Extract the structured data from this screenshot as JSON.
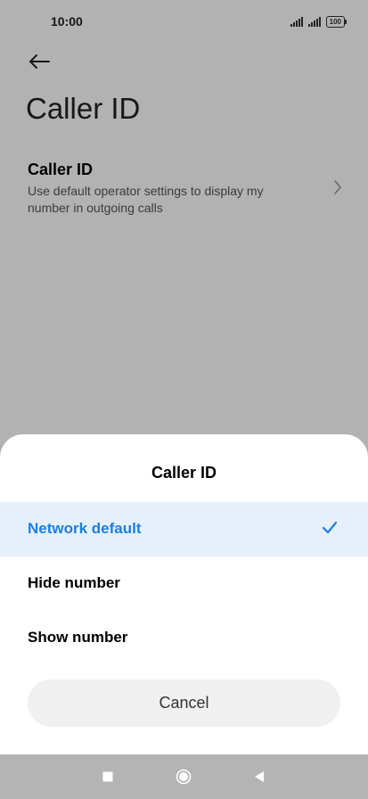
{
  "status_bar": {
    "time": "10:00",
    "battery": "100"
  },
  "page": {
    "title": "Caller ID"
  },
  "setting": {
    "title": "Caller ID",
    "summary": "Use default operator settings to display my number in outgoing calls"
  },
  "dialog": {
    "title": "Caller ID",
    "options": [
      {
        "label": "Network default",
        "selected": true
      },
      {
        "label": "Hide number",
        "selected": false
      },
      {
        "label": "Show number",
        "selected": false
      }
    ],
    "cancel_label": "Cancel"
  },
  "colors": {
    "accent": "#1a80e0",
    "selected_row": "#e6f0fb",
    "scrim": "rgba(0,0,0,0.30)",
    "nav_bar": "#b4b4b4"
  },
  "icons": {
    "back": "arrow-left-icon",
    "chevron": "chevron-right-icon",
    "check": "check-icon",
    "nav_recents": "square-icon",
    "nav_home": "circle-icon",
    "nav_back": "triangle-left-icon"
  }
}
